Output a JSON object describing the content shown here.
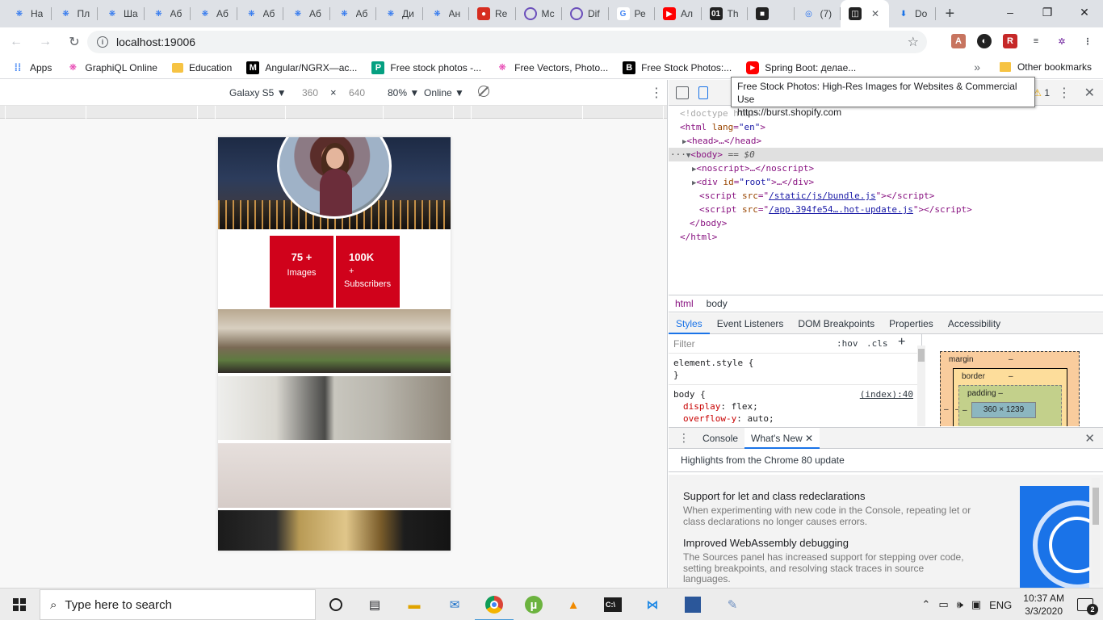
{
  "browser": {
    "tabs": [
      {
        "label": "На",
        "icon": "graphql-icon"
      },
      {
        "label": "Пл",
        "icon": "graphql-icon"
      },
      {
        "label": "Ша",
        "icon": "graphql-icon"
      },
      {
        "label": "Аб",
        "icon": "graphql-icon"
      },
      {
        "label": "Аб",
        "icon": "graphql-icon"
      },
      {
        "label": "Аб",
        "icon": "graphql-icon"
      },
      {
        "label": "Аб",
        "icon": "graphql-icon"
      },
      {
        "label": "Аб",
        "icon": "graphql-icon"
      },
      {
        "label": "Ди",
        "icon": "graphql-icon"
      },
      {
        "label": "Ан",
        "icon": "graphql-icon"
      },
      {
        "label": "Re",
        "icon": "red-circle-icon"
      },
      {
        "label": "Мс",
        "icon": "purple-ring-icon"
      },
      {
        "label": "Dif",
        "icon": "purple-ring-icon"
      },
      {
        "label": "Ре",
        "icon": "google-icon"
      },
      {
        "label": "Ал",
        "icon": "youtube-icon"
      },
      {
        "label": "Th",
        "icon": "binary-icon"
      },
      {
        "label": "",
        "icon": "dark-square-icon"
      },
      {
        "label": "(7)",
        "icon": "circle-icon"
      },
      {
        "label": "",
        "icon": "box-icon"
      },
      {
        "label": "Do",
        "icon": "download-icon"
      }
    ],
    "active_tab_index": 18,
    "new_tab": "+",
    "window_controls": {
      "minimize": "–",
      "maximize": "❐",
      "close": "✕"
    },
    "url": "localhost:19006",
    "bookmarks": [
      {
        "label": "Apps",
        "icon": "apps-grid-icon"
      },
      {
        "label": "GraphiQL Online",
        "icon": "graphql-icon"
      },
      {
        "label": "Education",
        "icon": "folder-icon"
      },
      {
        "label": "Angular/NGRX—ас...",
        "icon": "medium-icon"
      },
      {
        "label": "Free stock photos -...",
        "icon": "pexels-icon"
      },
      {
        "label": "Free Vectors, Photo...",
        "icon": "graphql-icon"
      },
      {
        "label": "Free Stock Photos:...",
        "icon": "burst-icon"
      },
      {
        "label": "Spring Boot: делае...",
        "icon": "youtube-icon"
      }
    ],
    "bookmarks_more": "»",
    "other_bookmarks": "Other bookmarks"
  },
  "device_toolbar": {
    "device": "Galaxy S5 ▼",
    "width": "360",
    "times": "×",
    "height": "640",
    "zoom": "80% ▼",
    "network": "Online ▼"
  },
  "app": {
    "stats": [
      {
        "number": "75 +",
        "label": "Images"
      },
      {
        "number": "100K",
        "label_line1": "+",
        "label_line2": "Subscribers"
      }
    ]
  },
  "tooltip": {
    "title": "Free Stock Photos: High-Res Images for Websites & Commercial Use",
    "url": "https://burst.shopify.com"
  },
  "devtools": {
    "warnings": "1",
    "dom": {
      "doctype": "<!doctype html>",
      "html_open_tag": "html",
      "html_lang_attr": "lang",
      "html_lang_val": "\"en\"",
      "head": "head",
      "body_tag": "body",
      "body_marker": "== $0",
      "noscript": "noscript",
      "div_attr": "id",
      "div_val": "\"root\"",
      "script1": "/static/js/bundle.js",
      "script2": "/app.394fe54….hot-update.js"
    },
    "breadcrumbs": [
      "html",
      "body"
    ],
    "panel_tabs": [
      "Styles",
      "Event Listeners",
      "DOM Breakpoints",
      "Properties",
      "Accessibility"
    ],
    "filter_placeholder": "Filter",
    "hov": ":hov",
    "cls": ".cls",
    "rule1_selector": "element.style {",
    "rule1_close": "}",
    "rule2_selector": "body {",
    "rule2_source": "(index):40",
    "rule2_props": [
      {
        "name": "display",
        "value": "flex;"
      },
      {
        "name": "overflow-y",
        "value": "auto;"
      }
    ],
    "box_model": {
      "margin": "margin",
      "margin_val": "–",
      "border": "border",
      "border_val": "–",
      "padding": "padding –",
      "content": "360 × 1239",
      "side": "–"
    },
    "drawer": {
      "tabs": [
        "Console",
        "What's New"
      ],
      "highlights": "Highlights from the Chrome 80 update",
      "items": [
        {
          "title": "Support for let and class redeclarations",
          "body": "When experimenting with new code in the Console, repeating let or class declarations no longer causes errors."
        },
        {
          "title": "Improved WebAssembly debugging",
          "body": "The Sources panel has increased support for stepping over code, setting breakpoints, and resolving stack traces in source languages."
        }
      ]
    }
  },
  "taskbar": {
    "search_placeholder": "Type here to search",
    "language": "ENG",
    "time": "10:37 AM",
    "date": "3/3/2020",
    "notifications": "2"
  }
}
